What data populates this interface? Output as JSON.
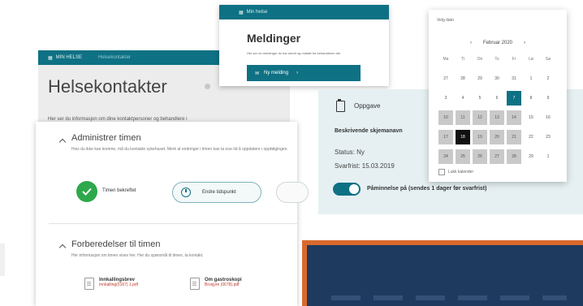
{
  "helsekontakter": {
    "tab_active": "MIN HELSE",
    "tab_inactive": "Helsekontakter",
    "title": "Helsekontakter",
    "description": "Her ser du informasjon om dine kontaktpersoner og behandlere i"
  },
  "meldinger": {
    "bar_label": "Min helse",
    "title": "Meldinger",
    "note": "Her ser du meldinger du har sendt og mottatt fra behandleren din",
    "button_label": "Ny melding"
  },
  "oppgave": {
    "title": "Oppgave",
    "subtitle": "Beskrivende skjemanavn",
    "status": "Status: Ny",
    "deadline": "Svarfrist: 15.03.2019",
    "toggle_label": "Påminnelse på (sendes 1 dager før svarfrist)"
  },
  "calendar": {
    "header": "Velg dato",
    "month_label": "Februar 2020",
    "weekdays": [
      "Ma",
      "Ti",
      "On",
      "To",
      "Fr",
      "Lø",
      "Sø"
    ],
    "rows": [
      [
        "27",
        "28",
        "29",
        "30",
        "31",
        "1",
        "2"
      ],
      [
        "3",
        "4",
        "5",
        "6",
        "7",
        "8",
        "9"
      ],
      [
        "10",
        "11",
        "12",
        "13",
        "14",
        "15",
        "16"
      ],
      [
        "17",
        "18",
        "19",
        "20",
        "21",
        "22",
        "23"
      ],
      [
        "24",
        "25",
        "26",
        "27",
        "28",
        "29",
        "1"
      ]
    ],
    "footer": "Lukk kalender"
  },
  "admin": {
    "section1_title": "Administrer timen",
    "section1_desc": "Hvis du ikke kan komme, må du kontakte sykehuset. Merk at endringer i timen kan ta noe tid å oppdatere i oppfølgingen.",
    "confirmed_label": "Timen bekreftet",
    "change_button": "Endre tidspunkt",
    "section2_title": "Forberedelser til timen",
    "section2_desc": "Her informasjon om timen vises her. Her du spørsmål til timen, ta kontakt.",
    "files": [
      {
        "name": "Innkallingsbrev",
        "meta": "Innkalling(0167) 1.pdf"
      },
      {
        "name": "Om gastroskopi",
        "meta": "Brosjyre (0678).pdf"
      }
    ]
  },
  "colors": {
    "accent": "#0f7184",
    "success": "#2ea84a",
    "banner_border": "#d8692c",
    "banner_fill": "#1e3a5f"
  }
}
